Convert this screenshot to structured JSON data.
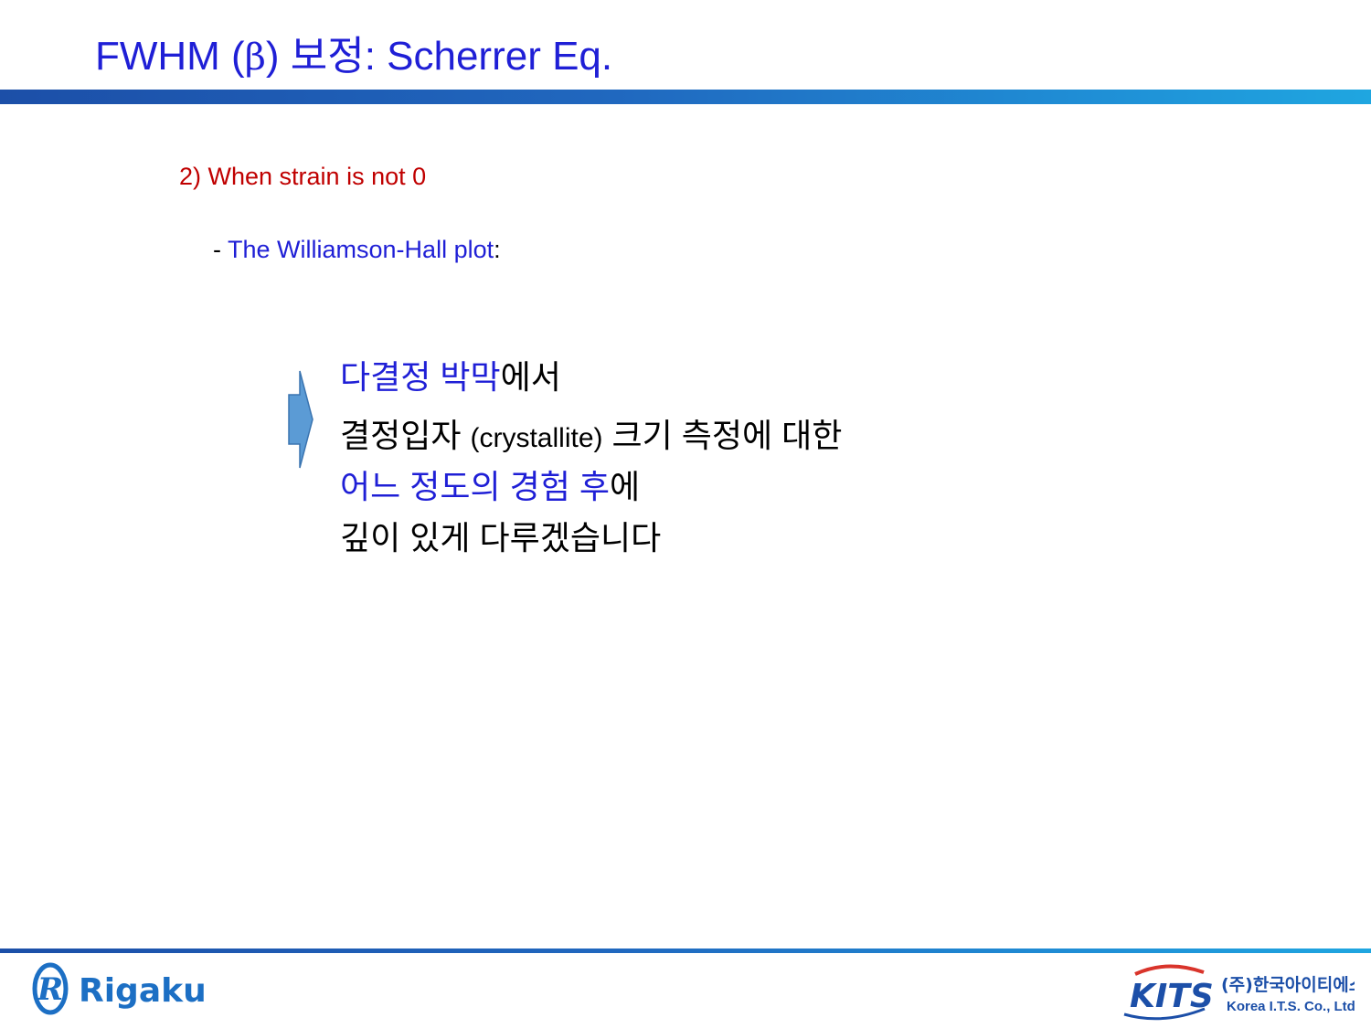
{
  "slide": {
    "title": {
      "prefix": "FWHM (",
      "symbol": "β",
      "suffix": ") 보정",
      "tail": ": Scherrer Eq."
    },
    "step_label": "2) When strain is not 0",
    "subitem": {
      "dash": "- ",
      "link_text": "The Williamson-Hall plot",
      "colon": ":"
    },
    "note": {
      "line1_blue": "다결정 박막",
      "line1_black": "에서",
      "line2_a": "결정입자 ",
      "line2_paren": "(crystallite)",
      "line2_b": " 크기 측정에 대한",
      "line3_blue": "어느 정도의 경험 후",
      "line3_black": "에",
      "line4": "깊이 있게 다루겠습니다"
    }
  },
  "footer": {
    "left_logo": {
      "text": "Rigaku",
      "color": "#1c6fc4",
      "icon": "rigaku-r-emblem"
    },
    "right_logo": {
      "brand": "KITS",
      "korean_name": "(주)한국아이티에스",
      "english_name": "Korea I.T.S. Co., Ltd.",
      "color": "#1c4fa8"
    }
  },
  "colors": {
    "title": "#1f1fd6",
    "step": "#c00000",
    "accent_blue": "#1f1fd6",
    "arrow_fill": "#5b9bd5",
    "bar_start": "#1c4fa8",
    "bar_end": "#1fa6e0"
  }
}
